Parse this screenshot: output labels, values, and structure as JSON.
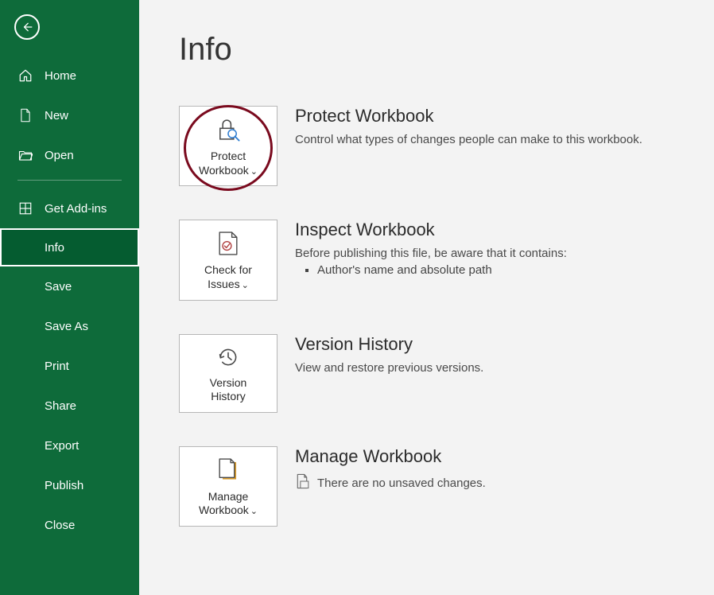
{
  "sidebar": {
    "home": "Home",
    "new": "New",
    "open": "Open",
    "addins": "Get Add-ins",
    "info": "Info",
    "save": "Save",
    "saveas": "Save As",
    "print": "Print",
    "share": "Share",
    "export": "Export",
    "publish": "Publish",
    "close": "Close"
  },
  "page": {
    "title": "Info"
  },
  "protect": {
    "tile_line1": "Protect",
    "tile_line2": "Workbook",
    "heading": "Protect Workbook",
    "desc": "Control what types of changes people can make to this workbook."
  },
  "inspect": {
    "tile_line1": "Check for",
    "tile_line2": "Issues",
    "heading": "Inspect Workbook",
    "desc": "Before publishing this file, be aware that it contains:",
    "bullet1": "Author's name and absolute path"
  },
  "version": {
    "tile_line1": "Version",
    "tile_line2": "History",
    "heading": "Version History",
    "desc": "View and restore previous versions."
  },
  "manage": {
    "tile_line1": "Manage",
    "tile_line2": "Workbook",
    "heading": "Manage Workbook",
    "desc": "There are no unsaved changes."
  }
}
